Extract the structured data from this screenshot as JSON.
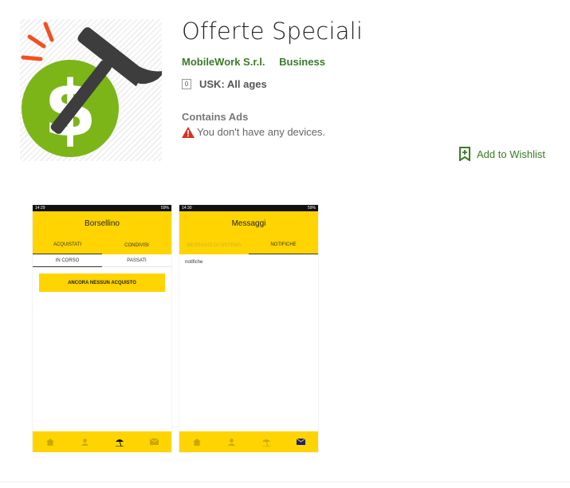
{
  "app": {
    "title": "Offerte Speciali",
    "developer": "MobileWork S.r.l.",
    "category": "Business",
    "rating_badge": "0",
    "rating": "USK: All ages",
    "ads_notice": "Contains Ads",
    "device_warning": "You don't have any devices.",
    "wishlist_label": "Add to Wishlist",
    "icon_name": "dollar-hammer-icon"
  },
  "colors": {
    "brand_green": "#3b7a2a",
    "icon_green": "#7cb518",
    "screenshot_yellow": "#ffd400",
    "warning_red": "#d93025"
  },
  "screenshots": [
    {
      "time": "14:29",
      "battery": "59%",
      "title": "Borsellino",
      "tabs": [
        "ACQUISTATI",
        "CONDIVISI"
      ],
      "subtabs": [
        "IN CORSO",
        "PASSATI"
      ],
      "button": "ANCORA NESSUN ACQUISTO",
      "nav_icons": [
        "home-icon",
        "person-icon",
        "beach-umbrella-icon",
        "mail-icon"
      ]
    },
    {
      "time": "14:30",
      "battery": "59%",
      "title": "Messaggi",
      "tabs": [
        "MESSAGGI DI SISTEMA",
        "NOTIFICHE"
      ],
      "body_text": "notifiche",
      "nav_icons": [
        "home-icon",
        "person-icon",
        "beach-umbrella-icon",
        "mail-icon"
      ]
    }
  ]
}
